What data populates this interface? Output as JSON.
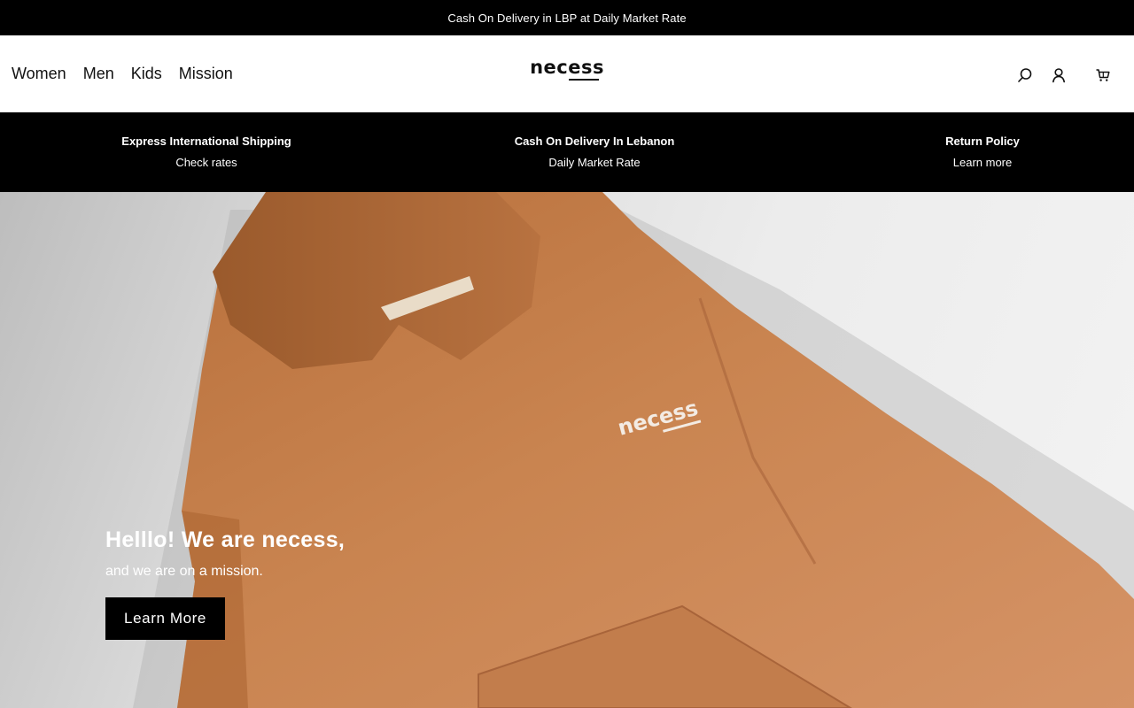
{
  "announcement": {
    "text": "Cash On Delivery in LBP at Daily Market Rate"
  },
  "header": {
    "nav": [
      "Women",
      "Men",
      "Kids",
      "Mission"
    ],
    "logo": "necess",
    "icons": {
      "search": "search-icon",
      "account": "account-icon",
      "cart": "cart-icon"
    }
  },
  "features": [
    {
      "title": "Express International Shipping",
      "subtitle": "Check rates"
    },
    {
      "title": "Cash On Delivery In Lebanon",
      "subtitle": "Daily Market Rate"
    },
    {
      "title": "Return Policy",
      "subtitle": "Learn more"
    }
  ],
  "hero": {
    "title": "Helllo! We are necess,",
    "subtitle": "and we are on a mission.",
    "button": "Learn More",
    "garment_logo": "necess"
  },
  "colors": {
    "bar": "#000000",
    "hoodie": "#c07a46",
    "text_light": "#ffffff"
  }
}
